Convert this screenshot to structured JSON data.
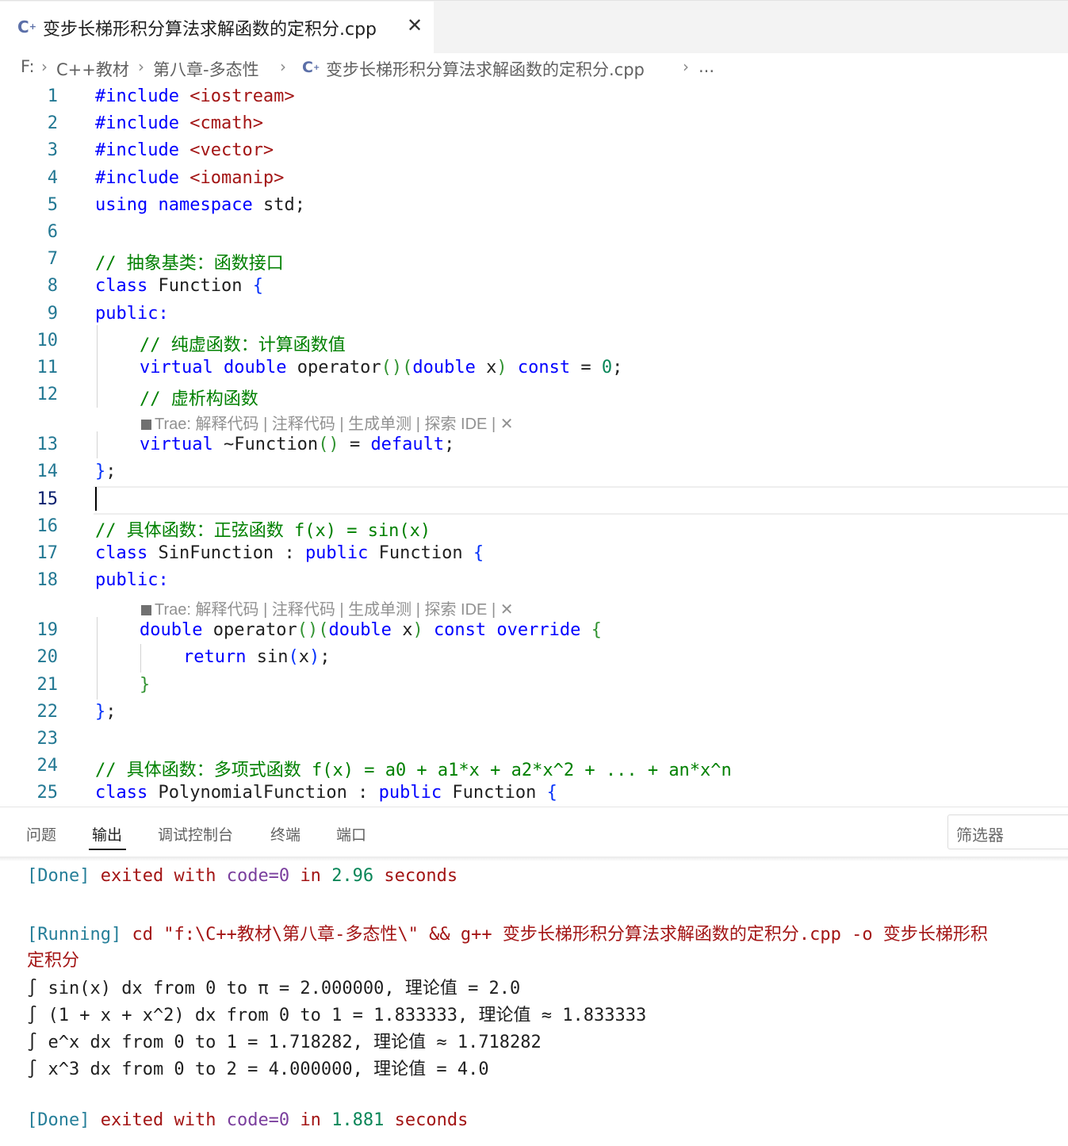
{
  "tab": {
    "icon": "cpp-file-icon",
    "title": "变步长梯形积分算法求解函数的定积分.cpp",
    "close": "✕"
  },
  "breadcrumb": {
    "drive": "F:",
    "folder1": "C++教材",
    "folder2": "第八章-多态性",
    "file": "变步长梯形积分算法求解函数的定积分.cpp",
    "more": "..."
  },
  "editor": {
    "line_numbers": [
      "1",
      "2",
      "3",
      "4",
      "5",
      "6",
      "7",
      "8",
      "9",
      "10",
      "11",
      "12",
      "13",
      "14",
      "15",
      "16",
      "17",
      "18",
      "19",
      "20",
      "21",
      "22",
      "23",
      "24",
      "25"
    ],
    "active_line": "15",
    "lines": {
      "l1": [
        "#include",
        "<iostream>"
      ],
      "l2": [
        "#include",
        "<cmath>"
      ],
      "l3": [
        "#include",
        "<vector>"
      ],
      "l4": [
        "#include",
        "<iomanip>"
      ],
      "l5": [
        "using",
        "namespace",
        "std;"
      ],
      "l7": "// 抽象基类：函数接口",
      "l8": [
        "class",
        "Function",
        "{"
      ],
      "l9": "public:",
      "l10": "// 纯虚函数：计算函数值",
      "l11": [
        "virtual",
        "double",
        "operator",
        "()",
        "(",
        "double",
        "x",
        ")",
        "const",
        "=",
        "0",
        ";"
      ],
      "l12": "// 虚析构函数",
      "l13": [
        "virtual",
        "~Function",
        "()",
        "=",
        "default",
        ";"
      ],
      "l14": [
        "}",
        ";"
      ],
      "l16": "// 具体函数：正弦函数 f(x) = sin(x)",
      "l17": [
        "class",
        "SinFunction",
        ":",
        "public",
        "Function",
        "{"
      ],
      "l18": "public:",
      "l19": [
        "double",
        "operator",
        "()",
        "(",
        "double",
        "x",
        ")",
        "const",
        "override",
        "{"
      ],
      "l20": [
        "return",
        "sin",
        "(",
        "x",
        ")",
        ";"
      ],
      "l21": "}",
      "l22": [
        "}",
        ";"
      ],
      "l24": "// 具体函数：多项式函数 f(x) = a0 + a1*x + a2*x^2 + ... + an*x^n",
      "l25": [
        "class",
        "PolynomialFunction",
        ":",
        "public",
        "Function",
        "{"
      ]
    },
    "codelens": {
      "prefix": "Trae:",
      "explain": "解释代码",
      "comment": "注释代码",
      "unittest": "生成单测",
      "explore": "探索 IDE",
      "sep": "|",
      "close": "✕"
    }
  },
  "panel": {
    "tabs": [
      "问题",
      "输出",
      "调试控制台",
      "终端",
      "端口"
    ],
    "active_tab": "输出",
    "filter_placeholder": "筛选器",
    "output": {
      "done1": [
        "[Done]",
        "exited",
        "with",
        "code=0",
        "in",
        "2.96",
        "seconds"
      ],
      "running_tag": "[Running]",
      "running_cmd": "cd \"f:\\C++教材\\第八章-多态性\\\" && g++ 变步长梯形积分算法求解函数的定积分.cpp -o 变步长梯形积",
      "running_cont": "定积分",
      "result1": "∫ sin(x) dx from 0 to π = 2.000000, 理论值 = 2.0",
      "result2": "∫ (1 + x + x^2) dx from 0 to 1 = 1.833333, 理论值 ≈ 1.833333",
      "result3": "∫ e^x dx from 0 to 1 = 1.718282, 理论值 ≈ 1.718282",
      "result4": "∫ x^3 dx from 0 to 2 = 4.000000, 理论值 = 4.0",
      "done2": [
        "[Done]",
        "exited",
        "with",
        "code=0",
        "in",
        "1.881",
        "seconds"
      ]
    }
  }
}
